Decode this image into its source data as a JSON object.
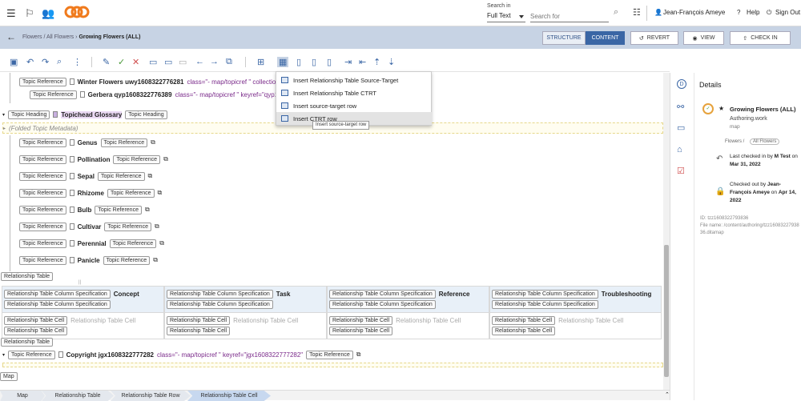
{
  "search": {
    "label": "Search in",
    "scope": "Full Text",
    "placeholder": "Search for"
  },
  "user": {
    "name": "Jean-François Ameye",
    "help": "Help",
    "signout": "Sign Out"
  },
  "nav": {
    "breadcrumb_path": "Flowers / All Flowers",
    "breadcrumb_sep": "›",
    "breadcrumb_current": "Growing Flowers (ALL)",
    "structure": "STRUCTURE",
    "content": "CONTENT",
    "revert": "REVERT",
    "view": "VIEW",
    "checkin": "CHECK IN"
  },
  "dropdown": {
    "items": [
      "Insert Relationship Table Source-Target",
      "Insert Relationship Table CTRT",
      "Insert source-target row",
      "Insert CTRT row"
    ],
    "tooltip": "Insert source-target row"
  },
  "editor": {
    "topic_ref": "Topic Reference",
    "topic_heading": "Topic Heading",
    "row1_name": "Winter Flowers uwy1608322776281",
    "row1_attr": "class=\"- map/topicref \" collection-t",
    "row2_name": "Gerbera qyp1608322776389",
    "row2_attr": "class=\"- map/topicref \"  keyref=\"qyp16",
    "glossary": "Topichead Glossary",
    "folded": "(Folded Topic Metadata)",
    "topics": [
      "Genus",
      "Pollination",
      "Sepal",
      "Rhizome",
      "Bulb",
      "Cultivar",
      "Perennial",
      "Panicle"
    ],
    "rel_table": "Relationship Table",
    "col_spec": "Relationship Table Column Specification",
    "rel_cell": "Relationship Table Cell",
    "columns": [
      "Concept",
      "Task",
      "Reference",
      "Troubleshooting"
    ],
    "copyright_name": "Copyright jgx1608322777282",
    "copyright_attr": "class=\"- map/topicref \"  keyref=\"jgx1608322777282\"",
    "map": "Map"
  },
  "statusbar": [
    "Map",
    "Relationship Table",
    "Relationship Table Row",
    "Relationship Table Cell"
  ],
  "details": {
    "title": "Details",
    "doc_title": "Growing Flowers (ALL)",
    "doc_type": "Authoring.work",
    "doc_kind": "map",
    "doc_path": "Flowers /",
    "doc_tag": "All Flowers",
    "last_checked_label": "Last checked in by",
    "last_checked_user": "M Test",
    "last_checked_on": "on",
    "last_checked_date": "Mar 31, 2022",
    "checked_out_label": "Checked out by",
    "checked_out_user": "Jean-François Ameye",
    "checked_out_on": "on",
    "checked_out_date": "Apr 14, 2022",
    "id_line": "ID: tzz1608322793836",
    "file_line": "File name: /content/authoring/tzz1608322793836.ditamap"
  },
  "colors": {
    "accent": "#3a66a5",
    "navbar": "#c7d3e4",
    "attr": "#7a2a8a"
  }
}
